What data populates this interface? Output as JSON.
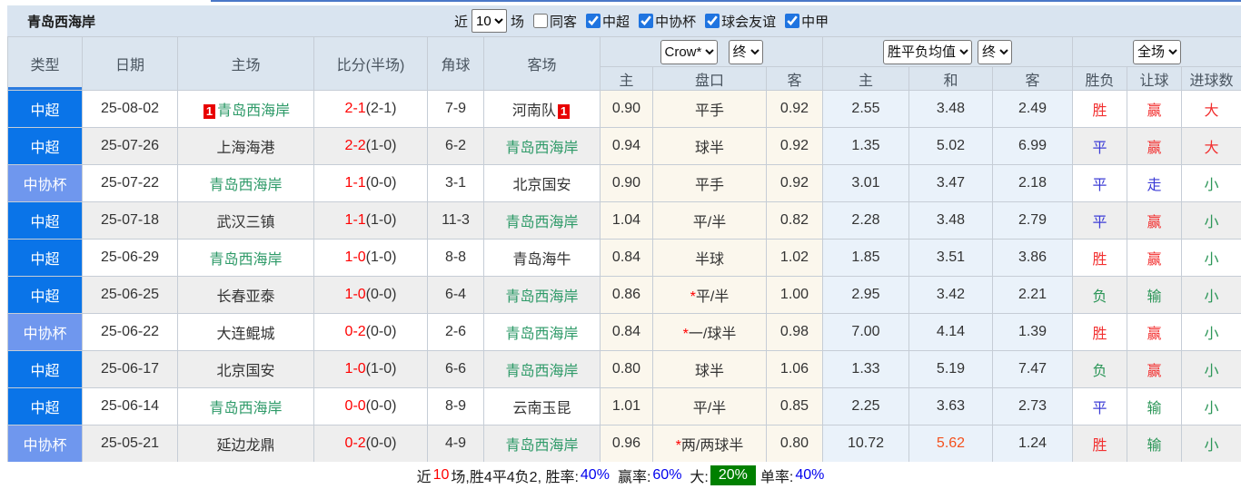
{
  "title": "青岛西海岸",
  "filter": {
    "near_label": "近",
    "recent_count": "10",
    "games_label": "场",
    "same_opponent_label": "同客",
    "same_opponent_checked": false,
    "leagues": [
      {
        "label": "中超",
        "checked": true
      },
      {
        "label": "中协杯",
        "checked": true
      },
      {
        "label": "球会友谊",
        "checked": true
      },
      {
        "label": "中甲",
        "checked": true
      }
    ]
  },
  "header": {
    "type": "类型",
    "date": "日期",
    "home": "主场",
    "score": "比分(半场)",
    "corners": "角球",
    "away": "客场",
    "ah_company_select": "Crow*",
    "ah_time_select": "终",
    "eu_company_select": "胜平负均值",
    "eu_time_select": "终",
    "scope_select": "全场",
    "ah_home": "主",
    "ah_line": "盘口",
    "ah_away": "客",
    "eu_home": "主",
    "eu_draw": "和",
    "eu_away": "客",
    "result": "胜负",
    "handicap": "让球",
    "goals": "进球数"
  },
  "rows": [
    {
      "league": "中超",
      "cup": false,
      "date": "25-08-02",
      "home": "青岛西海岸",
      "home_green": true,
      "home_badge": "1",
      "score": "2-1",
      "half": "(2-1)",
      "corners": "7-9",
      "away": "河南队",
      "away_green": false,
      "away_badge": "1",
      "ah_home": "0.90",
      "ah_star": "",
      "ah_line": "平手",
      "ah_away": "0.92",
      "eu_home": "2.55",
      "eu_draw": "3.48",
      "eu_draw_hot": false,
      "eu_away": "2.49",
      "result": {
        "t": "胜",
        "c": "red"
      },
      "handicap": {
        "t": "赢",
        "c": "red"
      },
      "goals": {
        "t": "大",
        "c": "red"
      }
    },
    {
      "league": "中超",
      "cup": false,
      "date": "25-07-26",
      "home": "上海海港",
      "home_green": false,
      "home_badge": "",
      "score": "2-2",
      "half": "(1-0)",
      "corners": "6-2",
      "away": "青岛西海岸",
      "away_green": true,
      "away_badge": "",
      "ah_home": "0.94",
      "ah_star": "",
      "ah_line": "球半",
      "ah_away": "0.92",
      "eu_home": "1.35",
      "eu_draw": "5.02",
      "eu_draw_hot": false,
      "eu_away": "6.99",
      "result": {
        "t": "平",
        "c": "blue"
      },
      "handicap": {
        "t": "赢",
        "c": "red"
      },
      "goals": {
        "t": "大",
        "c": "red"
      }
    },
    {
      "league": "中协杯",
      "cup": true,
      "date": "25-07-22",
      "home": "青岛西海岸",
      "home_green": true,
      "home_badge": "",
      "score": "1-1",
      "half": "(0-0)",
      "corners": "3-1",
      "away": "北京国安",
      "away_green": false,
      "away_badge": "",
      "ah_home": "0.90",
      "ah_star": "",
      "ah_line": "平手",
      "ah_away": "0.92",
      "eu_home": "3.01",
      "eu_draw": "3.47",
      "eu_draw_hot": false,
      "eu_away": "2.18",
      "result": {
        "t": "平",
        "c": "blue"
      },
      "handicap": {
        "t": "走",
        "c": "blue"
      },
      "goals": {
        "t": "小",
        "c": "green"
      }
    },
    {
      "league": "中超",
      "cup": false,
      "date": "25-07-18",
      "home": "武汉三镇",
      "home_green": false,
      "home_badge": "",
      "score": "1-1",
      "half": "(1-0)",
      "corners": "11-3",
      "away": "青岛西海岸",
      "away_green": true,
      "away_badge": "",
      "ah_home": "1.04",
      "ah_star": "",
      "ah_line": "平/半",
      "ah_away": "0.82",
      "eu_home": "2.28",
      "eu_draw": "3.48",
      "eu_draw_hot": false,
      "eu_away": "2.79",
      "result": {
        "t": "平",
        "c": "blue"
      },
      "handicap": {
        "t": "赢",
        "c": "red"
      },
      "goals": {
        "t": "小",
        "c": "green"
      }
    },
    {
      "league": "中超",
      "cup": false,
      "date": "25-06-29",
      "home": "青岛西海岸",
      "home_green": true,
      "home_badge": "",
      "score": "1-0",
      "half": "(1-0)",
      "corners": "8-8",
      "away": "青岛海牛",
      "away_green": false,
      "away_badge": "",
      "ah_home": "0.84",
      "ah_star": "",
      "ah_line": "半球",
      "ah_away": "1.02",
      "eu_home": "1.85",
      "eu_draw": "3.51",
      "eu_draw_hot": false,
      "eu_away": "3.86",
      "result": {
        "t": "胜",
        "c": "red"
      },
      "handicap": {
        "t": "赢",
        "c": "red"
      },
      "goals": {
        "t": "小",
        "c": "green"
      }
    },
    {
      "league": "中超",
      "cup": false,
      "date": "25-06-25",
      "home": "长春亚泰",
      "home_green": false,
      "home_badge": "",
      "score": "1-0",
      "half": "(0-0)",
      "corners": "6-4",
      "away": "青岛西海岸",
      "away_green": true,
      "away_badge": "",
      "ah_home": "0.86",
      "ah_star": "*",
      "ah_line": "平/半",
      "ah_away": "1.00",
      "eu_home": "2.95",
      "eu_draw": "3.42",
      "eu_draw_hot": false,
      "eu_away": "2.21",
      "result": {
        "t": "负",
        "c": "green"
      },
      "handicap": {
        "t": "输",
        "c": "green"
      },
      "goals": {
        "t": "小",
        "c": "green"
      }
    },
    {
      "league": "中协杯",
      "cup": true,
      "date": "25-06-22",
      "home": "大连鲲城",
      "home_green": false,
      "home_badge": "",
      "score": "0-2",
      "half": "(0-0)",
      "corners": "2-6",
      "away": "青岛西海岸",
      "away_green": true,
      "away_badge": "",
      "ah_home": "0.84",
      "ah_star": "*",
      "ah_line": "一/球半",
      "ah_away": "0.98",
      "eu_home": "7.00",
      "eu_draw": "4.14",
      "eu_draw_hot": false,
      "eu_away": "1.39",
      "result": {
        "t": "胜",
        "c": "red"
      },
      "handicap": {
        "t": "赢",
        "c": "red"
      },
      "goals": {
        "t": "小",
        "c": "green"
      }
    },
    {
      "league": "中超",
      "cup": false,
      "date": "25-06-17",
      "home": "北京国安",
      "home_green": false,
      "home_badge": "",
      "score": "1-0",
      "half": "(1-0)",
      "corners": "6-6",
      "away": "青岛西海岸",
      "away_green": true,
      "away_badge": "",
      "ah_home": "0.80",
      "ah_star": "",
      "ah_line": "球半",
      "ah_away": "1.06",
      "eu_home": "1.33",
      "eu_draw": "5.19",
      "eu_draw_hot": false,
      "eu_away": "7.47",
      "result": {
        "t": "负",
        "c": "green"
      },
      "handicap": {
        "t": "赢",
        "c": "red"
      },
      "goals": {
        "t": "小",
        "c": "green"
      }
    },
    {
      "league": "中超",
      "cup": false,
      "date": "25-06-14",
      "home": "青岛西海岸",
      "home_green": true,
      "home_badge": "",
      "score": "0-0",
      "half": "(0-0)",
      "corners": "8-9",
      "away": "云南玉昆",
      "away_green": false,
      "away_badge": "",
      "ah_home": "1.01",
      "ah_star": "",
      "ah_line": "平/半",
      "ah_away": "0.85",
      "eu_home": "2.25",
      "eu_draw": "3.63",
      "eu_draw_hot": false,
      "eu_away": "2.73",
      "result": {
        "t": "平",
        "c": "blue"
      },
      "handicap": {
        "t": "输",
        "c": "green"
      },
      "goals": {
        "t": "小",
        "c": "green"
      }
    },
    {
      "league": "中协杯",
      "cup": true,
      "date": "25-05-21",
      "home": "延边龙鼎",
      "home_green": false,
      "home_badge": "",
      "score": "0-2",
      "half": "(0-0)",
      "corners": "4-9",
      "away": "青岛西海岸",
      "away_green": true,
      "away_badge": "",
      "ah_home": "0.96",
      "ah_star": "*",
      "ah_line": "两/两球半",
      "ah_away": "0.80",
      "eu_home": "10.72",
      "eu_draw": "5.62",
      "eu_draw_hot": true,
      "eu_away": "1.24",
      "result": {
        "t": "胜",
        "c": "red"
      },
      "handicap": {
        "t": "输",
        "c": "green"
      },
      "goals": {
        "t": "小",
        "c": "green"
      }
    }
  ],
  "summary": {
    "seg_near": "近",
    "count": "10",
    "seg_record": "场,胜4平4负2, 胜率:",
    "win_pct": "40%",
    "seg_let": "赢率:",
    "let_pct": "60%",
    "seg_big": "大:",
    "big_pct": "20%",
    "seg_odd": "单率:",
    "odd_pct": "40%"
  },
  "colors": {
    "super_league_blue": "#0a74e8",
    "cup_blue": "#6f97ee",
    "team_green": "#2e9a68",
    "score_red": "#ff0000",
    "win_red": "#f23030",
    "draw_blue": "#3c3cd6",
    "lose_green": "#2c9658",
    "hot_odds_orange": "#f4511e",
    "big_badge_green": "#008000",
    "rate_blue": "#0000ee",
    "header_bg": "#dbe5ef",
    "bar_bg": "#d9e4f0",
    "handicap_col_bg": "#fbf7ed",
    "europe_col_bg": "#eaf2fa",
    "badge_red": "#e80000"
  }
}
